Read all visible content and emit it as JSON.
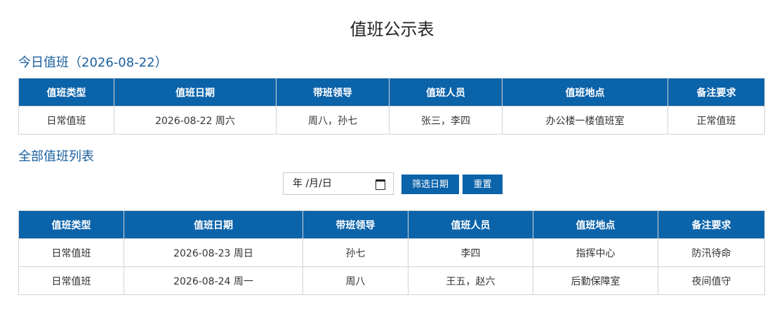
{
  "page": {
    "title": "值班公示表"
  },
  "today": {
    "section_title": "今日值班（2026-08-22）",
    "headers": [
      "值班类型",
      "值班日期",
      "带班领导",
      "值班人员",
      "值班地点",
      "备注要求"
    ],
    "rows": [
      [
        "日常值班",
        "2026-08-22 周六",
        "周八，孙七",
        "张三，李四",
        "办公楼一楼值班室",
        "正常值班"
      ]
    ]
  },
  "all": {
    "section_title": "全部值班列表",
    "filter": {
      "date_placeholder": "年 /月/日",
      "filter_button": "筛选日期",
      "reset_button": "重置"
    },
    "headers": [
      "值班类型",
      "值班日期",
      "带班领导",
      "值班人员",
      "值班地点",
      "备注要求"
    ],
    "rows": [
      [
        "日常值班",
        "2026-08-23 周日",
        "孙七",
        "李四",
        "指挥中心",
        "防汛待命"
      ],
      [
        "日常值班",
        "2026-08-24 周一",
        "周八",
        "王五，赵六",
        "后勤保障室",
        "夜间值守"
      ]
    ]
  }
}
